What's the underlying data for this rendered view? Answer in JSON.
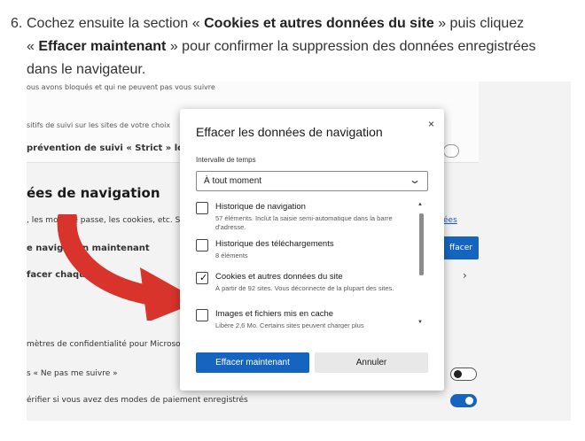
{
  "instruction": {
    "number": "6.",
    "line1_prefix": "Cochez ensuite la section « ",
    "line1_bold": "Cookies et autres données du site",
    "line1_suffix": " » puis cliquez",
    "line2_prefix": "« ",
    "line2_bold": "Effacer maintenant",
    "line2_suffix": " » pour confirmer la suppression des données enregistrées",
    "line3": "dans le navigateur."
  },
  "settings_bg": {
    "line1": "ous avons bloqués et qui ne peuvent pas vous suivre",
    "line2": "sitifs de suivi sur les sites de votre choix",
    "line3": "prévention de suivi « Strict » lors de l",
    "heading": "ées de navigation",
    "line4": ", les mots de passe, les cookies, etc. Se",
    "link": "ées",
    "line5": "e navigation maintenant",
    "blue_button": "ffacer",
    "line6": "facer chaque fo",
    "line7": "mètres de confidentialité pour Microso",
    "line8": "s « Ne pas me suivre »",
    "line9": "érifier si vous avez des modes de paiement enregistrés"
  },
  "dialog": {
    "title": "Effacer les données de navigation",
    "close": "×",
    "time_label": "Intervalle de temps",
    "time_value": "À tout moment",
    "items": [
      {
        "title": "Historique de navigation",
        "desc": "57 éléments. Inclut la saisie semi-automatique dans la barre d'adresse.",
        "checked": false
      },
      {
        "title": "Historique des téléchargements",
        "desc": "8 éléments",
        "checked": false
      },
      {
        "title": "Cookies et autres données du site",
        "desc": "À partir de 92 sites. Vous déconnecte de la plupart des sites.",
        "checked": true
      },
      {
        "title": "Images et fichiers mis en cache",
        "desc": "Libère 2,6 Mo. Certains sites peuvent charger plus",
        "checked": false
      }
    ],
    "primary_button": "Effacer maintenant",
    "secondary_button": "Annuler"
  },
  "colors": {
    "accent_blue": "#1565c0",
    "arrow_red": "#d8342c"
  }
}
